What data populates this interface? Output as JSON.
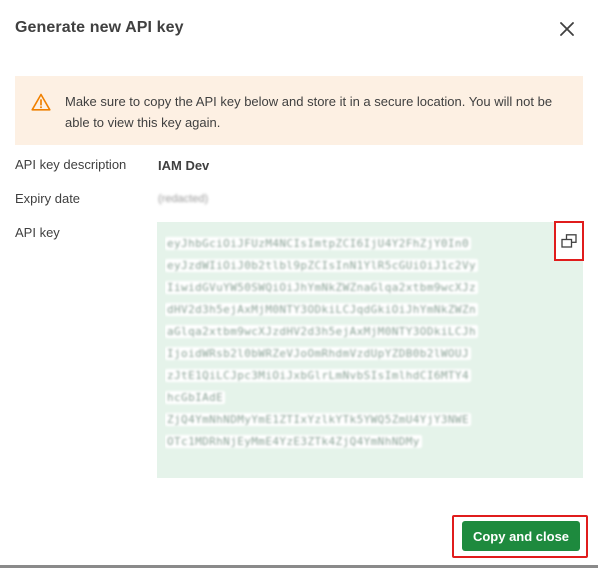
{
  "dialog": {
    "title": "Generate new API key",
    "close_icon": "close-icon"
  },
  "warning": {
    "icon": "warning-icon",
    "text": "Make sure to copy the API key below and store it in a secure location. You will not be able to view this key again.",
    "color": "#f08000"
  },
  "fields": {
    "description_label": "API key description",
    "description_value": "IAM Dev",
    "expiry_label": "Expiry date",
    "expiry_value": "(redacted)",
    "api_key_label": "API key"
  },
  "api_key": {
    "redacted_lines": [
      "eyJhbGciOiJFUzM4NCIsImtpZCI6IjU4Y2FhZjY0In0",
      "eyJzdWIiOiJ0b2tlbl9pZCIsInN1YlR5cGUiOiJ1c2Vy",
      "IiwidGVuYW50SWQiOiJhYmNkZWZnaGlqa2xtbm9wcXJz",
      "dHV2d3h5ejAxMjM0NTY3ODkiLCJqdGkiOiJhYmNkZWZn",
      "aGlqa2xtbm9wcXJzdHV2d3h5ejAxMjM0NTY3ODkiLCJh",
      "IjoidWRsb2l0bWRZeVJoOmRhdmVzdUpYZDB0b2lWOUJ",
      "zJtE1QiLCJpc3MiOiJxbGlrLmNvbSIsImlhdCI6MTY4",
      "hcGbIAdE",
      "ZjQ4YmNhNDMyYmE1ZTIxYzlkYTk5YWQ5ZmU4YjY3NWE",
      "OTc1MDRhNjEyMmE4YzE3ZTk4ZjQ4YmNhNDMy"
    ],
    "copy_icon": "copy-icon"
  },
  "footer": {
    "copy_close_label": "Copy and close"
  },
  "colors": {
    "warning_bg": "#fdf0e3",
    "key_bg": "#e5f3ea",
    "primary": "#1e8a3e",
    "highlight": "#e01c1c"
  }
}
